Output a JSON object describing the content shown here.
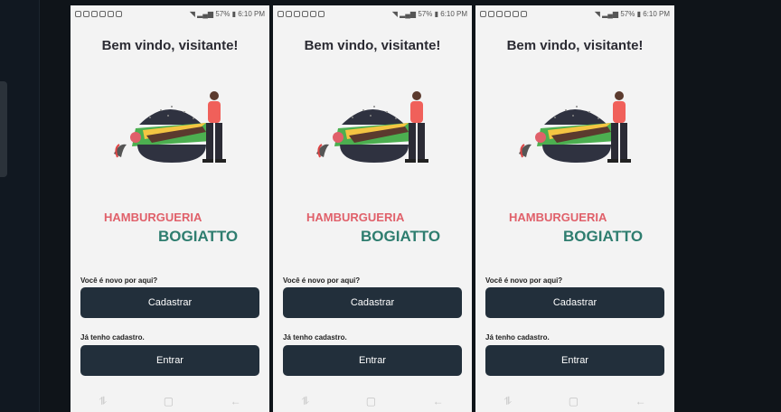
{
  "status": {
    "time": "6:10 PM",
    "battery": "57%"
  },
  "screen": {
    "title": "Bem vindo, visitante!",
    "brand_line1": "HAMBURGUERIA",
    "brand_line2": "BOGIATTO",
    "new_here_label": "Você é novo por aqui?",
    "register_button": "Cadastrar",
    "have_account_label": "Já tenho cadastro.",
    "login_button": "Entrar"
  },
  "icons": {
    "nav_recent": "recent-apps-icon",
    "nav_home": "home-icon",
    "nav_back": "back-icon"
  },
  "colors": {
    "brand_red": "#e0606a",
    "brand_green": "#2e7d6f",
    "button_bg": "#222f3b",
    "screen_bg": "#f3f3f3",
    "page_bg": "#0f1419"
  }
}
